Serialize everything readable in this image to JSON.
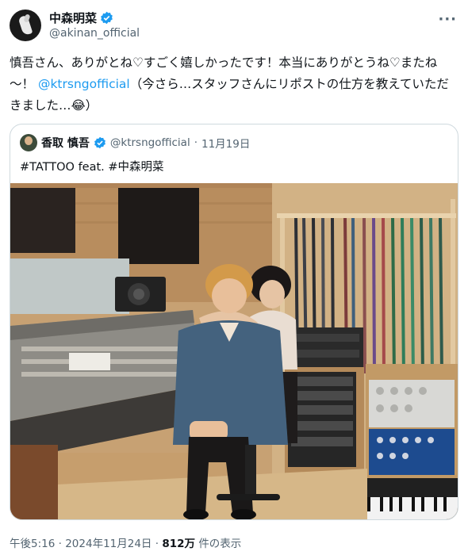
{
  "post": {
    "display_name": "中森明菜",
    "handle": "@akinan_official",
    "more_label": "···",
    "text_part1": "慎吾さん、ありがとね♡すごく嬉しかったです！本当にありがとうね♡またね～！ ",
    "mention": "@ktrsngofficial",
    "text_part2": "（今さら…スタッフさんにリポストの仕方を教えていただきました…😂）"
  },
  "quote": {
    "display_name": "香取 慎吾",
    "handle": "@ktrsngofficial",
    "separator": "·",
    "date": "11月19日",
    "text": "#TATTOO feat. #中森明菜"
  },
  "footer": {
    "time": "午後5:16",
    "separator1": "·",
    "date": "2024年11月24日",
    "separator2": "·",
    "views_count": "812万",
    "views_label": "件の表示"
  },
  "colors": {
    "accent": "#1d9bf0",
    "text": "#0f1419",
    "secondary": "#536471",
    "border": "#cfd9de"
  }
}
